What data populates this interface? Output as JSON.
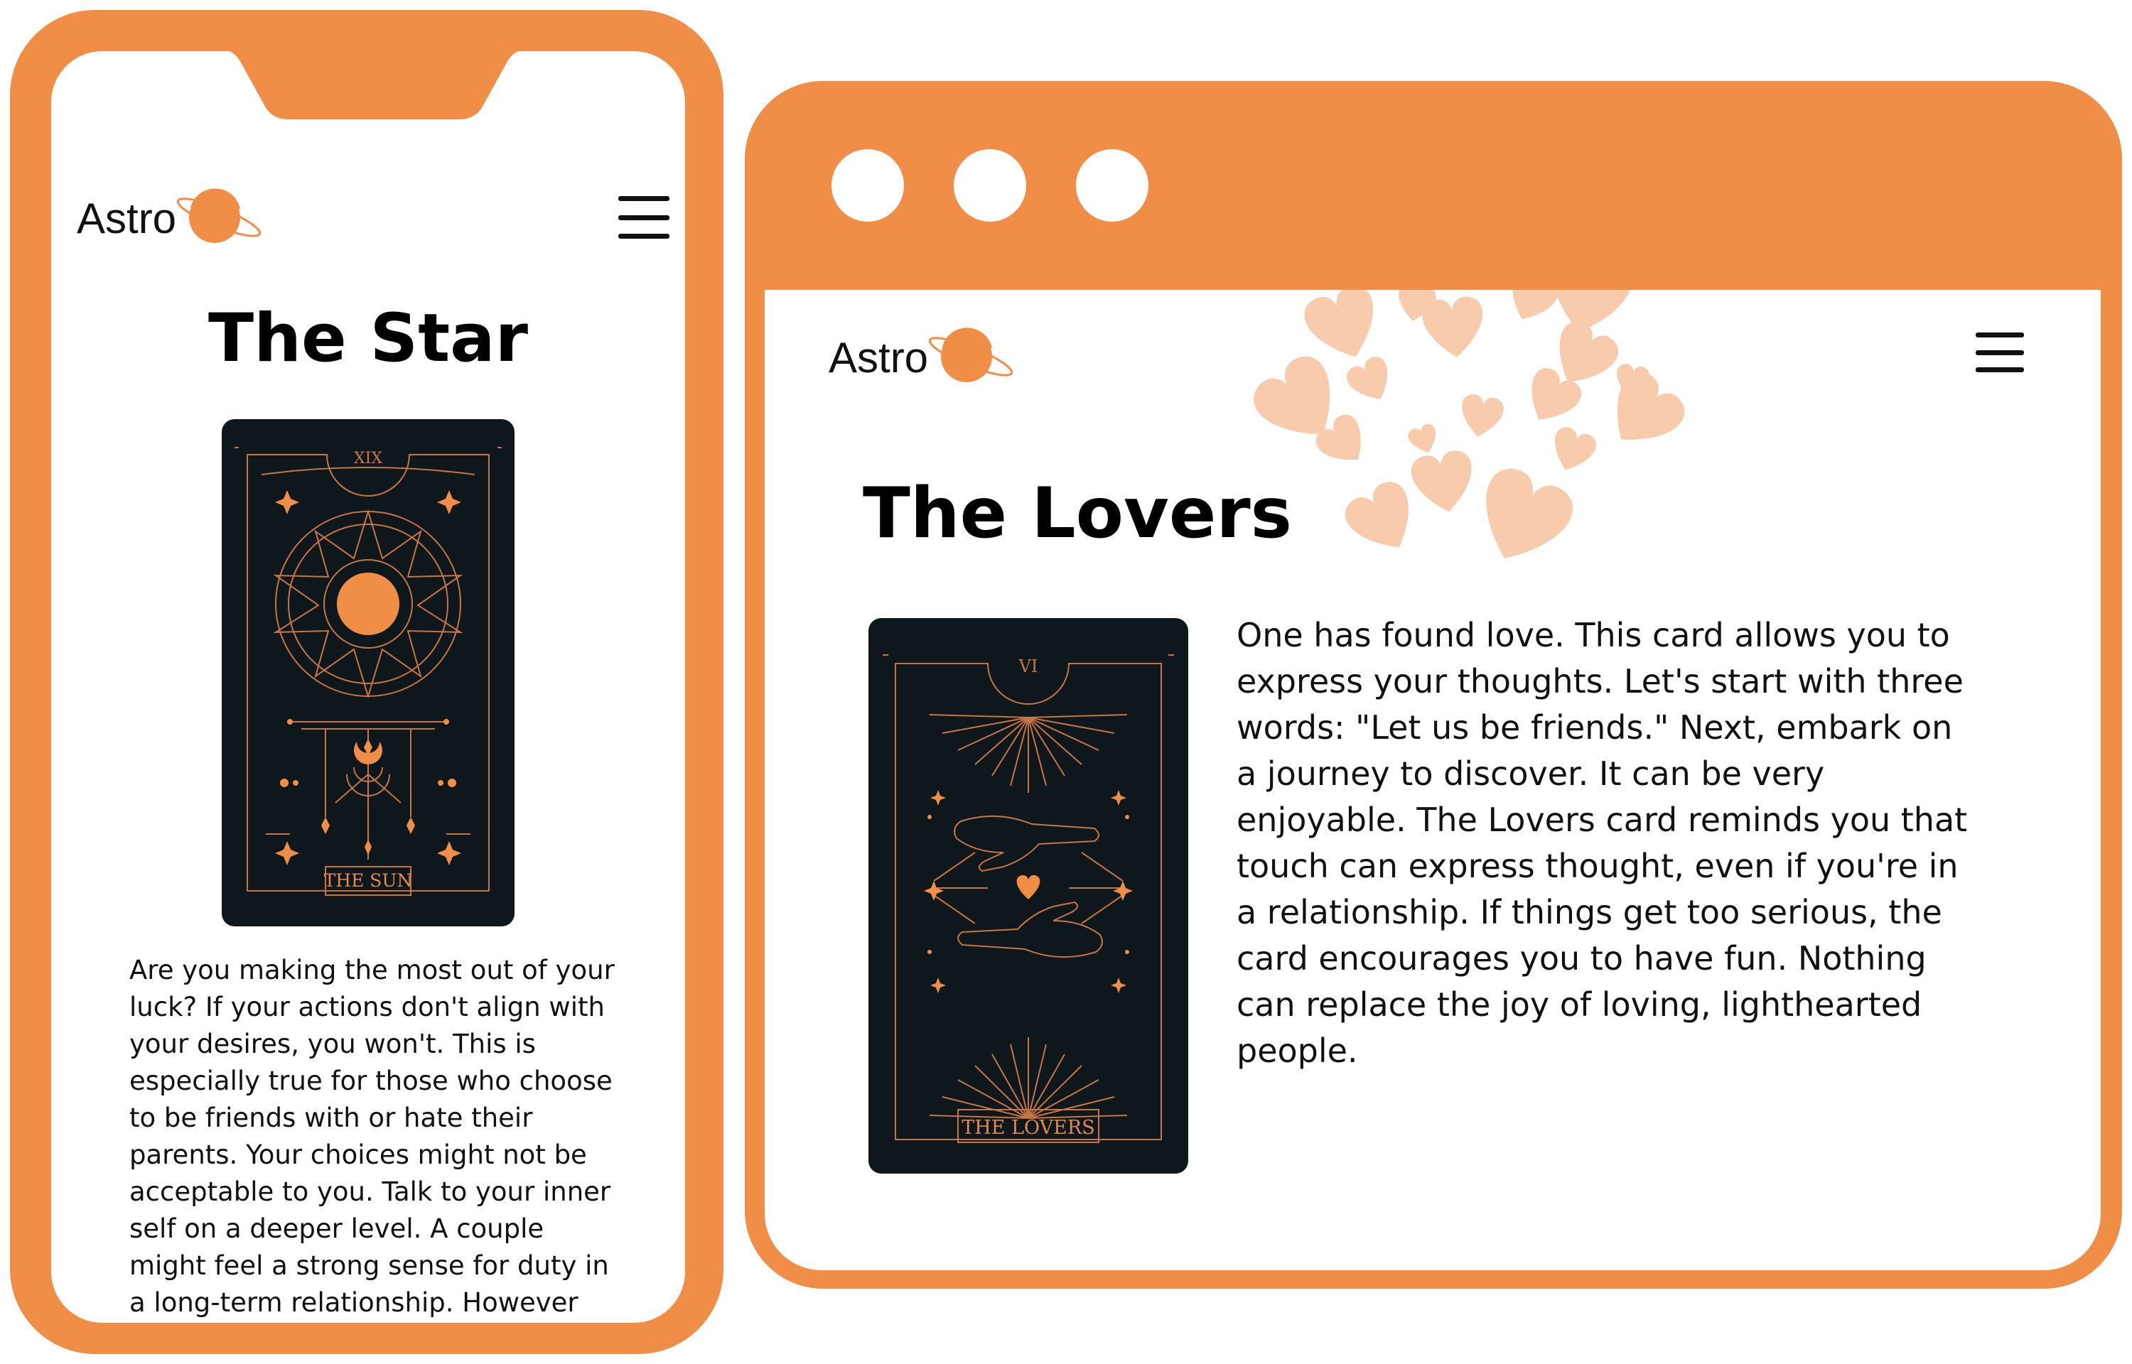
{
  "colors": {
    "accent": "#F08E48",
    "card_bg": "#0D171C",
    "heart": "#F8CBAD",
    "text": "#111111"
  },
  "mobile": {
    "brand": "Astro",
    "menu_icon": "hamburger-menu-icon",
    "title": "The Star",
    "card": {
      "numeral": "XIX",
      "name": "THE SUN"
    },
    "body": "Are you making the most out of your luck? If your actions don't align with your desires, you won't. This is especially true for those who choose to be friends with or hate their parents. Your choices might not be acceptable to you. Talk to your inner self on a deeper level. A couple might feel a strong sense for duty in a long-term relationship. However"
  },
  "desktop": {
    "window_controls": [
      "window-dot",
      "window-dot",
      "window-dot"
    ],
    "brand": "Astro",
    "menu_icon": "hamburger-menu-icon",
    "title": "The Lovers",
    "card": {
      "numeral": "VI",
      "name": "THE LOVERS"
    },
    "body": "One has found love. This card allows you to express your thoughts. Let's start with three words: \"Let us be friends.\" Next, embark on a journey to discover. It can be very enjoyable. The Lovers card reminds you that touch can express thought, even if you're in a relationship. If things get too serious, the card encourages you to have fun. Nothing can replace the joy of loving, lighthearted people."
  }
}
